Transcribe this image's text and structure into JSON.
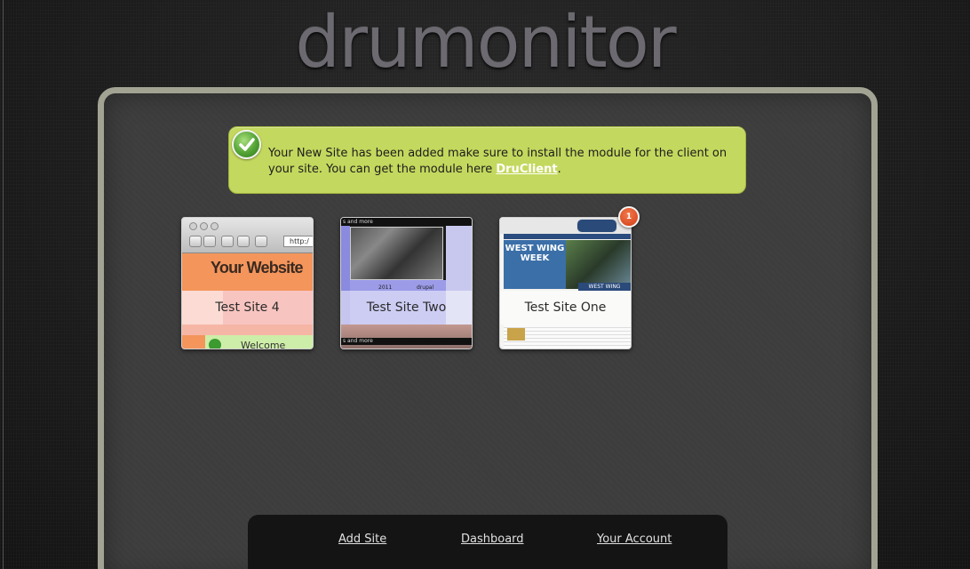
{
  "header": {
    "logo_text": "drumonitor"
  },
  "message": {
    "text_before_link": "Your New Site has been added make sure to install the module for the client on your site. You can get the module here ",
    "link_text": "DruClient",
    "text_after_link": ".",
    "icon": "check-icon",
    "color": "#c3d85e"
  },
  "sites": [
    {
      "name": "Test Site 4",
      "thumbnail_text": "Your Website",
      "thumbnail_url_text": "http:/",
      "thumbnail_welcome": "Welcome"
    },
    {
      "name": "Test Site Two",
      "thumbnail_top_text": "s and more",
      "thumbnail_year": "2011",
      "thumbnail_drupal": "drupal"
    },
    {
      "name": "Test Site One",
      "thumbnail_banner": "WEST WING WEEK",
      "thumbnail_caption": "WEST WING",
      "badge": "1"
    }
  ],
  "footer": {
    "links": [
      "Add Site",
      "Dashboard",
      "Your Account"
    ]
  },
  "colors": {
    "panel_border": "#a3a393",
    "panel_bg": "#3d3d3d",
    "badge": "#d23b14"
  }
}
